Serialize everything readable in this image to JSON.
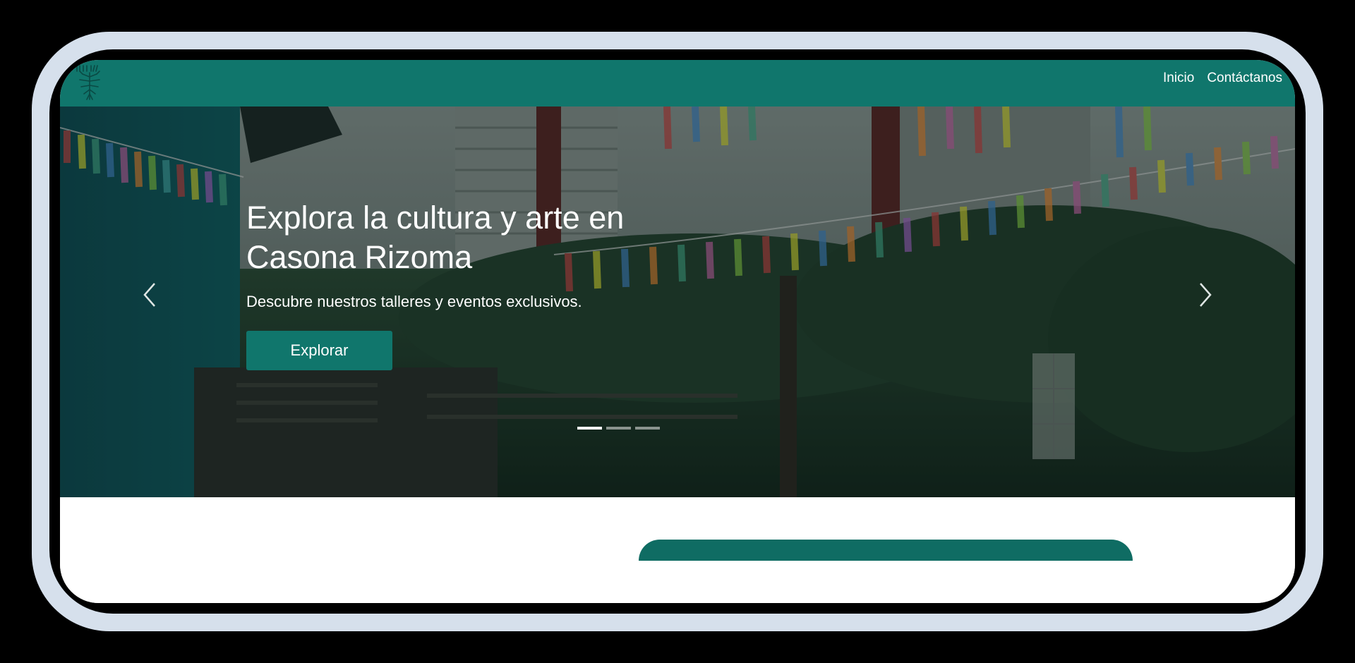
{
  "nav": {
    "links": [
      "Inicio",
      "Contáctanos"
    ]
  },
  "hero": {
    "title": "Explora la cultura y arte en Casona Rizoma",
    "subtitle": "Descubre nuestros talleres y eventos exclusivos.",
    "button_label": "Explorar"
  },
  "carousel": {
    "slide_count": 3,
    "active_index": 0
  },
  "colors": {
    "accent": "#10766c",
    "frame": "#d6e0ec",
    "text_light": "#ffffff"
  },
  "icons": {
    "logo": "tree-roots-logo-icon",
    "prev": "chevron-left-icon",
    "next": "chevron-right-icon"
  }
}
